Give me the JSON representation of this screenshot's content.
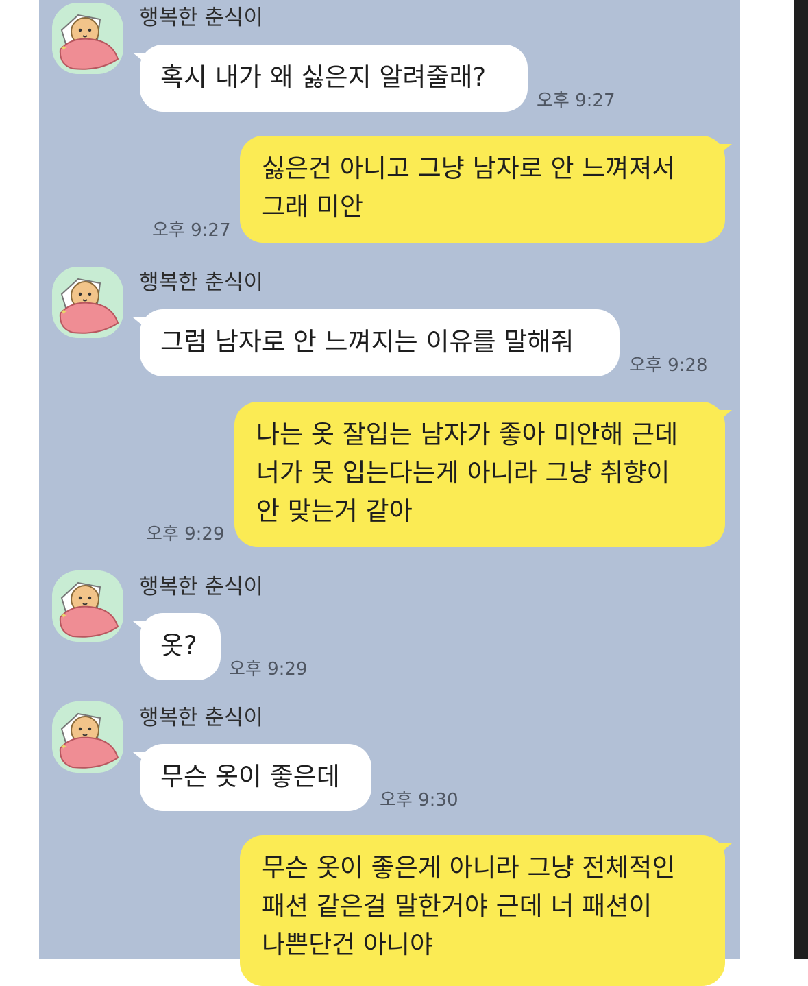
{
  "sender": {
    "name": "행복한 춘식이",
    "avatar_icon": "choonsik-sleeping-avatar-icon"
  },
  "colors": {
    "chat_background": "#b2c0d6",
    "incoming_bubble": "#ffffff",
    "outgoing_bubble": "#fbeb54"
  },
  "messages": [
    {
      "from": "other",
      "sender_name": "행복한 춘식이",
      "lines": [
        "혹시 내가 왜 싫은지 알려줄래?"
      ],
      "time": "오후 9:27"
    },
    {
      "from": "me",
      "lines": [
        "싫은건 아니고 그냥 남자로 안 느껴져서",
        "그래 미안"
      ],
      "time": "오후 9:27"
    },
    {
      "from": "other",
      "sender_name": "행복한 춘식이",
      "lines": [
        "그럼 남자로 안 느껴지는 이유를 말해줘"
      ],
      "time": "오후 9:28"
    },
    {
      "from": "me",
      "lines": [
        "나는 옷 잘입는 남자가 좋아 미안해 근데",
        "너가 못 입는다는게 아니라 그냥 취향이",
        "안 맞는거 같아"
      ],
      "time": "오후 9:29"
    },
    {
      "from": "other",
      "sender_name": "행복한 춘식이",
      "lines": [
        "옷?"
      ],
      "time": "오후 9:29"
    },
    {
      "from": "other",
      "sender_name": "행복한 춘식이",
      "lines": [
        "무슨 옷이 좋은데"
      ],
      "time": "오후 9:30"
    },
    {
      "from": "me",
      "lines": [
        "무슨 옷이 좋은게 아니라 그냥 전체적인",
        "패션 같은걸 말한거야 근데 너 패션이",
        "나쁜단건 아니야"
      ]
    }
  ]
}
